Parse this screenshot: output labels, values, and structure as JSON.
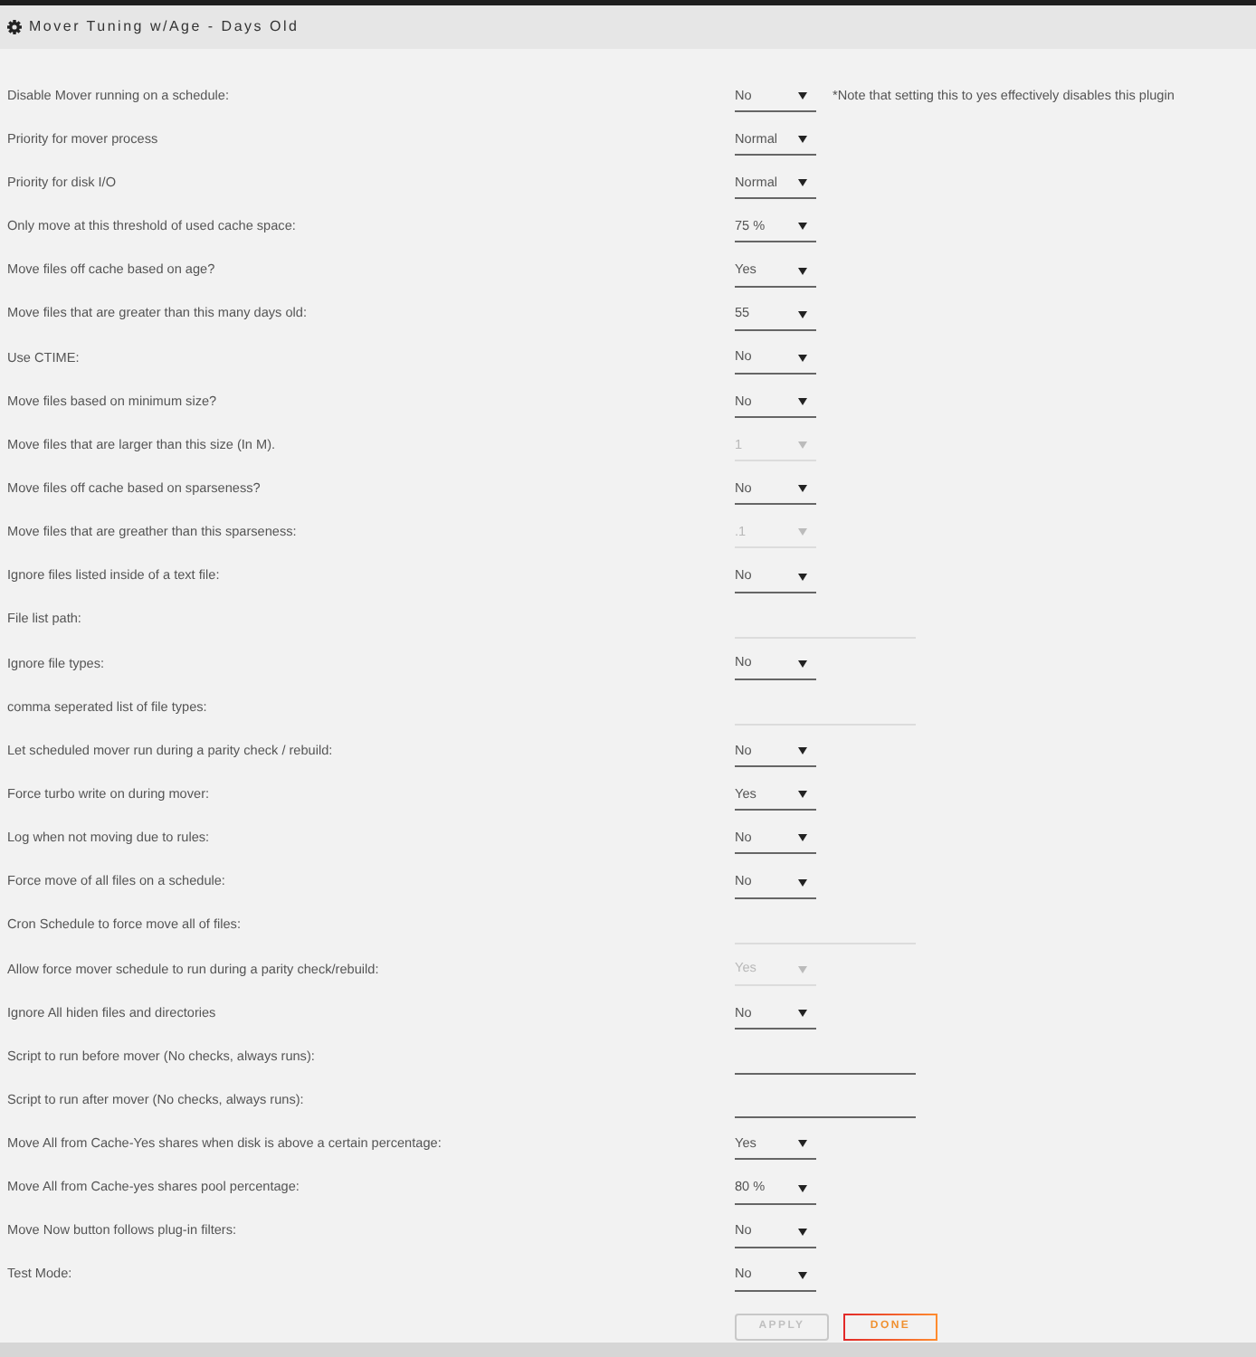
{
  "header": {
    "title": "Mover Tuning w/Age - Days Old"
  },
  "settings": [
    {
      "label": "Disable Mover running on a schedule:",
      "kind": "select",
      "value": "No",
      "disabled": false,
      "note": "*Note that setting this to yes effectively disables this plugin"
    },
    {
      "label": "Priority for mover process",
      "kind": "select",
      "value": "Normal",
      "disabled": false
    },
    {
      "label": "Priority for disk I/O",
      "kind": "select",
      "value": "Normal",
      "disabled": false
    },
    {
      "label": "Only move at this threshold of used cache space:",
      "kind": "select",
      "value": "75 %",
      "disabled": false
    },
    {
      "label": "Move files off cache based on age?",
      "kind": "select",
      "value": "Yes",
      "disabled": false
    },
    {
      "label": "Move files that are greater than this many days old:",
      "kind": "select",
      "value": "55",
      "disabled": false
    },
    {
      "label": "Use CTIME:",
      "kind": "select",
      "value": "No",
      "disabled": false
    },
    {
      "label": "Move files based on minimum size?",
      "kind": "select",
      "value": "No",
      "disabled": false
    },
    {
      "label": "Move files that are larger than this size (In M).",
      "kind": "select",
      "value": "1",
      "disabled": true
    },
    {
      "label": "Move files off cache based on sparseness?",
      "kind": "select",
      "value": "No",
      "disabled": false
    },
    {
      "label": "Move files that are greather than this sparseness:",
      "kind": "select",
      "value": ".1",
      "disabled": true
    },
    {
      "label": "Ignore files listed inside of a text file:",
      "kind": "select",
      "value": "No",
      "disabled": false
    },
    {
      "label": "File list path:",
      "kind": "text",
      "disabled": true
    },
    {
      "label": "Ignore file types:",
      "kind": "select",
      "value": "No",
      "disabled": false
    },
    {
      "label": "comma seperated list of file types:",
      "kind": "text",
      "disabled": true
    },
    {
      "label": "Let scheduled mover run during a parity check / rebuild:",
      "kind": "select",
      "value": "No",
      "disabled": false
    },
    {
      "label": "Force turbo write on during mover:",
      "kind": "select",
      "value": "Yes",
      "disabled": false
    },
    {
      "label": "Log when not moving due to rules:",
      "kind": "select",
      "value": "No",
      "disabled": false
    },
    {
      "label": "Force move of all files on a schedule:",
      "kind": "select",
      "value": "No",
      "disabled": false
    },
    {
      "label": "Cron Schedule to force move all of files:",
      "kind": "text",
      "disabled": true
    },
    {
      "label": "Allow force mover schedule to run during a parity check/rebuild:",
      "kind": "select",
      "value": "Yes",
      "disabled": true
    },
    {
      "label": "Ignore All hiden files and directories",
      "kind": "select",
      "value": "No",
      "disabled": false
    },
    {
      "label": "Script to run before mover (No checks, always runs):",
      "kind": "text",
      "disabled": false
    },
    {
      "label": "Script to run after mover (No checks, always runs):",
      "kind": "text",
      "disabled": false
    },
    {
      "label": "Move All from Cache-Yes shares when disk is above a certain percentage:",
      "kind": "select",
      "value": "Yes",
      "disabled": false
    },
    {
      "label": "Move All from Cache-yes shares pool percentage:",
      "kind": "select",
      "value": "80 %",
      "disabled": false
    },
    {
      "label": "Move Now button follows plug-in filters:",
      "kind": "select",
      "value": "No",
      "disabled": false
    },
    {
      "label": "Test Mode:",
      "kind": "select",
      "value": "No",
      "disabled": false
    }
  ],
  "buttons": [
    {
      "label": "APPLY",
      "disabled": true
    },
    {
      "label": "DONE",
      "disabled": false
    }
  ]
}
